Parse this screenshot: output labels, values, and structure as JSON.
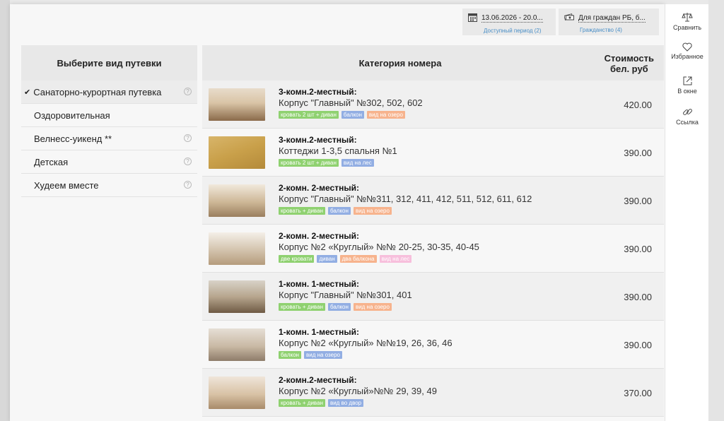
{
  "filters": {
    "date": {
      "value": "13.06.2026 - 20.0...",
      "label": "Доступный период (2)"
    },
    "citizenship": {
      "value": "Для граждан РБ, б...",
      "label": "Гражданство (4)"
    }
  },
  "sidebar_right": {
    "compare": "Сравнить",
    "favorites": "Избранное",
    "window": "В окне",
    "link": "Ссылка"
  },
  "left": {
    "title": "Выберите вид путевки",
    "items": [
      {
        "label": "Санаторно-курортная путевка",
        "active": true,
        "help": true
      },
      {
        "label": "Оздоровительная",
        "active": false,
        "help": false
      },
      {
        "label": "Велнесс-уикенд **",
        "active": false,
        "help": true
      },
      {
        "label": "Детская",
        "active": false,
        "help": true
      },
      {
        "label": "Худеем вместе",
        "active": false,
        "help": true
      }
    ]
  },
  "table": {
    "col_category": "Категория номера",
    "col_price_1": "Стоимость",
    "col_price_2": "бел. руб",
    "rows": [
      {
        "name": "3-комн.2-местный:",
        "building": "Корпус \"Главный\" №302, 502, 602",
        "price": "420.00",
        "tags": [
          {
            "t": "кровать 2 шт + диван",
            "c": "#8fd170"
          },
          {
            "t": "балкон",
            "c": "#92aee3"
          },
          {
            "t": "вид на озеро",
            "c": "#f7b38d"
          }
        ]
      },
      {
        "name": "3-комн.2-местный:",
        "building": "Коттеджи 1-3,5 спальня №1",
        "price": "390.00",
        "tags": [
          {
            "t": "кровать 2 шт + диван",
            "c": "#8fd170"
          },
          {
            "t": "вид на лес",
            "c": "#92aee3"
          }
        ]
      },
      {
        "name": "2-комн. 2-местный:",
        "building": "Корпус \"Главный\" №№311, 312, 411, 412, 511, 512, 611, 612",
        "price": "390.00",
        "tags": [
          {
            "t": "кровать + диван",
            "c": "#8fd170"
          },
          {
            "t": "балкон",
            "c": "#92aee3"
          },
          {
            "t": "вид на озеро",
            "c": "#f7b38d"
          }
        ]
      },
      {
        "name": "2-комн. 2-местный:",
        "building": "Корпус №2 «Круглый» №№ 20-25, 30-35, 40-45",
        "price": "390.00",
        "tags": [
          {
            "t": "две кровати",
            "c": "#8fd170"
          },
          {
            "t": "диван",
            "c": "#92aee3"
          },
          {
            "t": "два балкона",
            "c": "#f7b38d"
          },
          {
            "t": "вид на лес",
            "c": "#f7bfdc"
          }
        ]
      },
      {
        "name": "1-комн. 1-местный:",
        "building": "Корпус \"Главный\" №№301, 401",
        "price": "390.00",
        "tags": [
          {
            "t": "кровать + диван",
            "c": "#8fd170"
          },
          {
            "t": "балкон",
            "c": "#92aee3"
          },
          {
            "t": "вид на озеро",
            "c": "#f7b38d"
          }
        ]
      },
      {
        "name": "1-комн. 1-местный:",
        "building": "Корпус №2 «Круглый» №№19, 26, 36, 46",
        "price": "390.00",
        "tags": [
          {
            "t": "балкон",
            "c": "#8fd170"
          },
          {
            "t": "вид на озеро",
            "c": "#92aee3"
          }
        ]
      },
      {
        "name": "2-комн.2-местный:",
        "building": "Корпус №2 «Круглый»№№ 29, 39, 49",
        "price": "370.00",
        "tags": [
          {
            "t": "кровать + диван",
            "c": "#8fd170"
          },
          {
            "t": "вид во двор",
            "c": "#92aee3"
          }
        ]
      }
    ]
  }
}
